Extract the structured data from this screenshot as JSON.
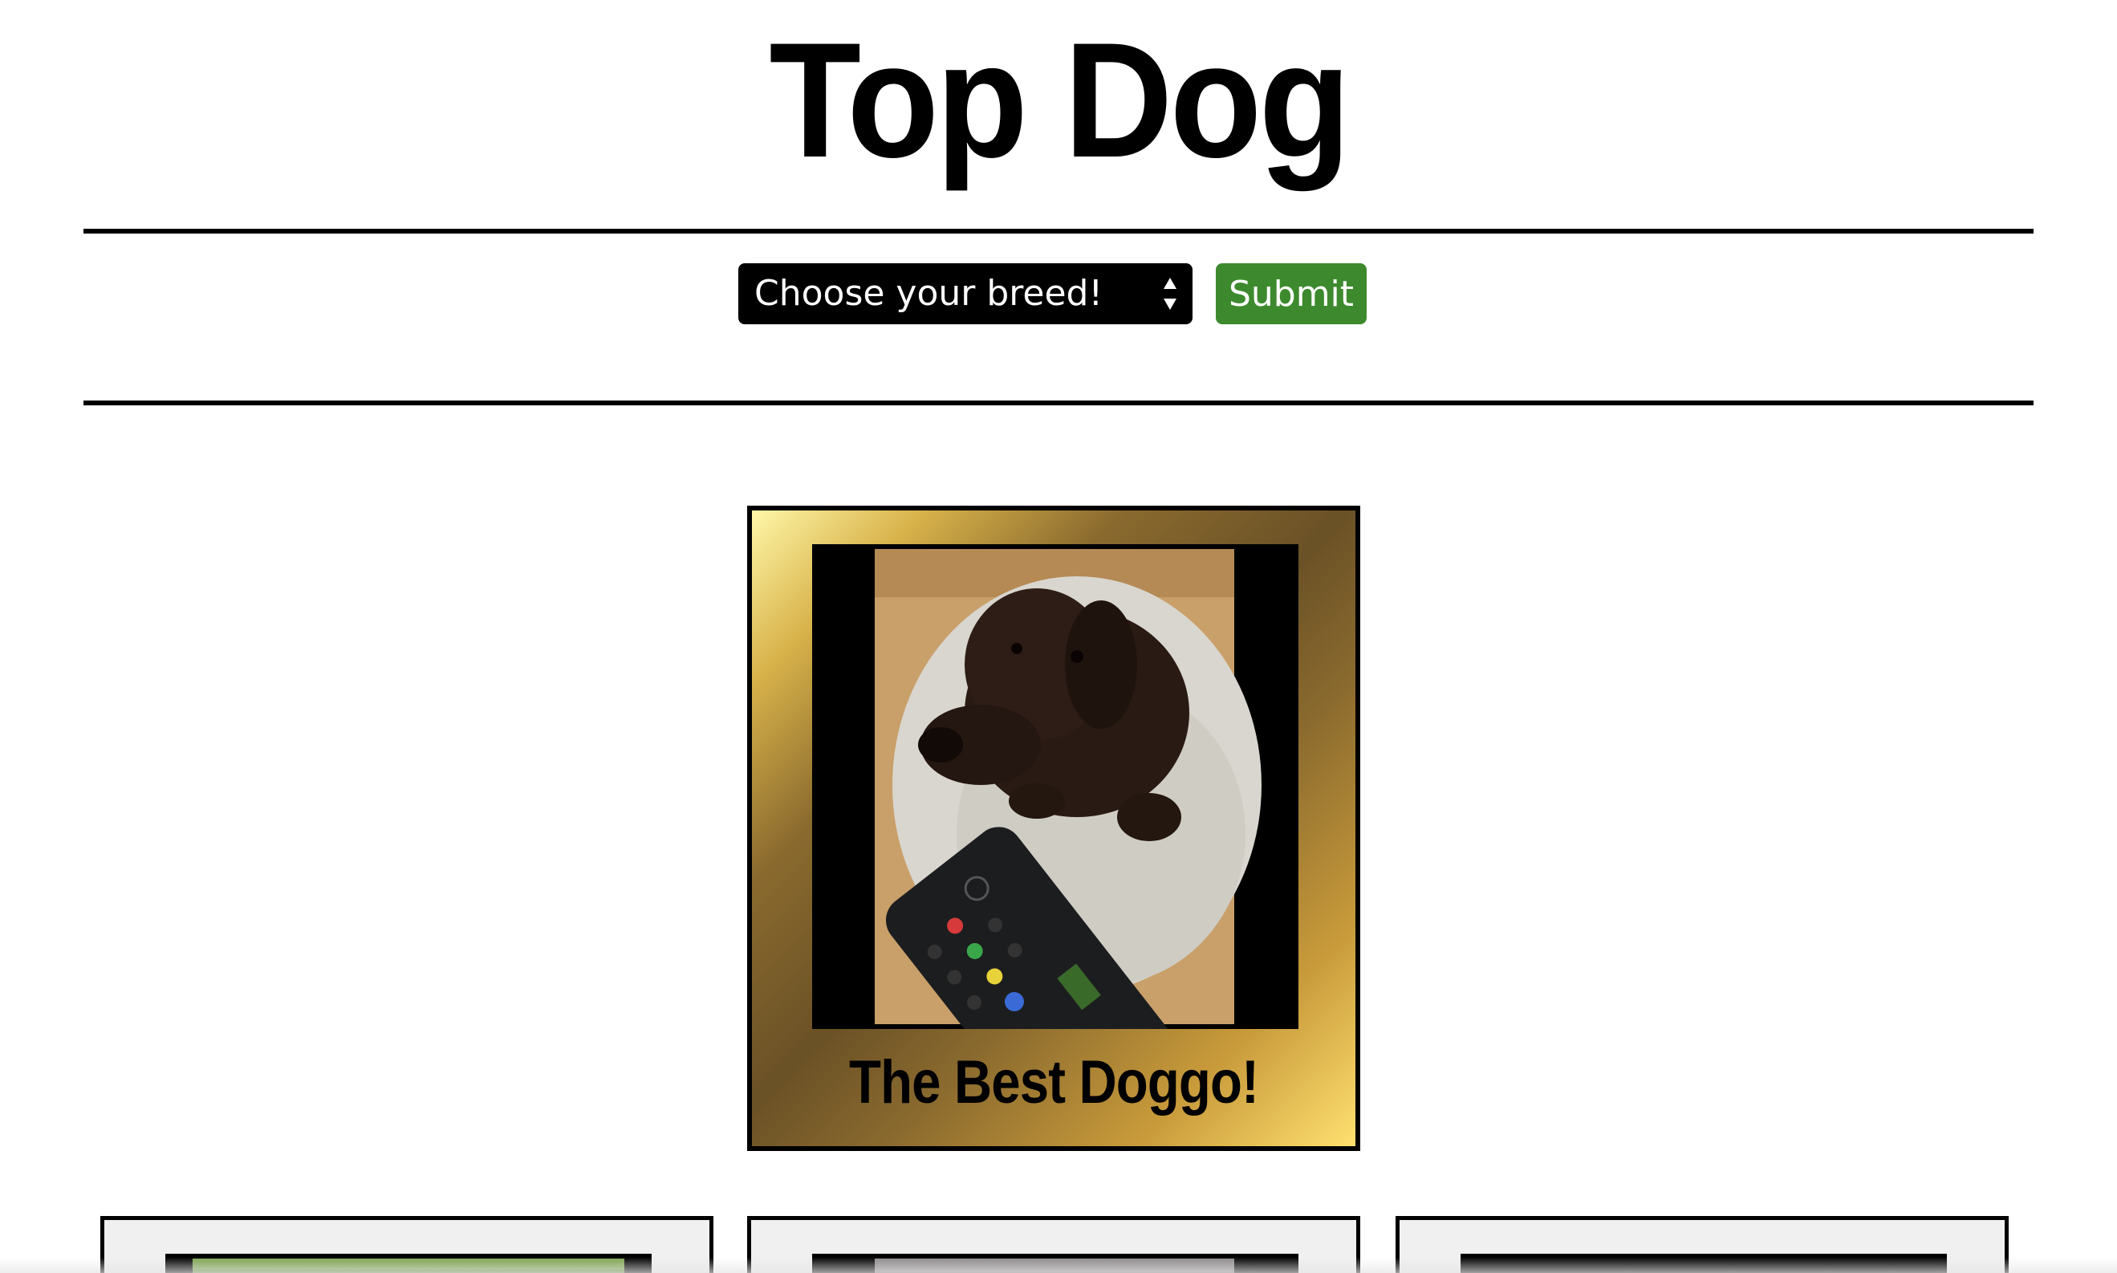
{
  "header": {
    "title": "Top Dog"
  },
  "form": {
    "breed_select": {
      "selected": "Choose your breed!"
    },
    "submit_label": "Submit"
  },
  "featured": {
    "caption": "The Best Doggo!"
  },
  "colors": {
    "submit_green": "#3d8a2e",
    "gold": "#c89a3a",
    "select_bg": "#000000"
  },
  "gallery": {
    "items": [
      {
        "image": "dog-on-grass-photo"
      },
      {
        "image": "dog-photo"
      },
      {
        "image": "dog-photo-dark"
      }
    ]
  }
}
